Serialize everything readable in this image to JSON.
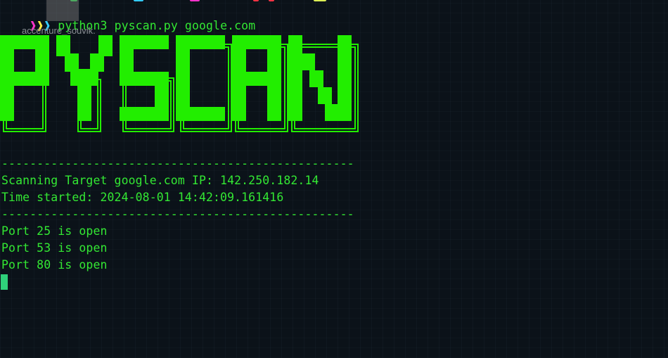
{
  "terminal": {
    "prompt_symbol": "❱❱❱",
    "command": "python3 pyscan.py google.com",
    "tooltip": "accenture_souvik.",
    "banner_text": "PYSCAN",
    "separator": "--------------------------------------------------",
    "target_line": "Scanning Target google.com IP: 142.250.182.14",
    "time_line": "Time started: 2024-08-01 14:42:09.161416",
    "ports": [
      "Port 25 is open",
      "Port 53 is open",
      "Port 80 is open"
    ]
  },
  "colors": {
    "background": "#0b1219",
    "text": "#33e833",
    "banner": "#22ee00",
    "cursor": "#2fd07a"
  }
}
